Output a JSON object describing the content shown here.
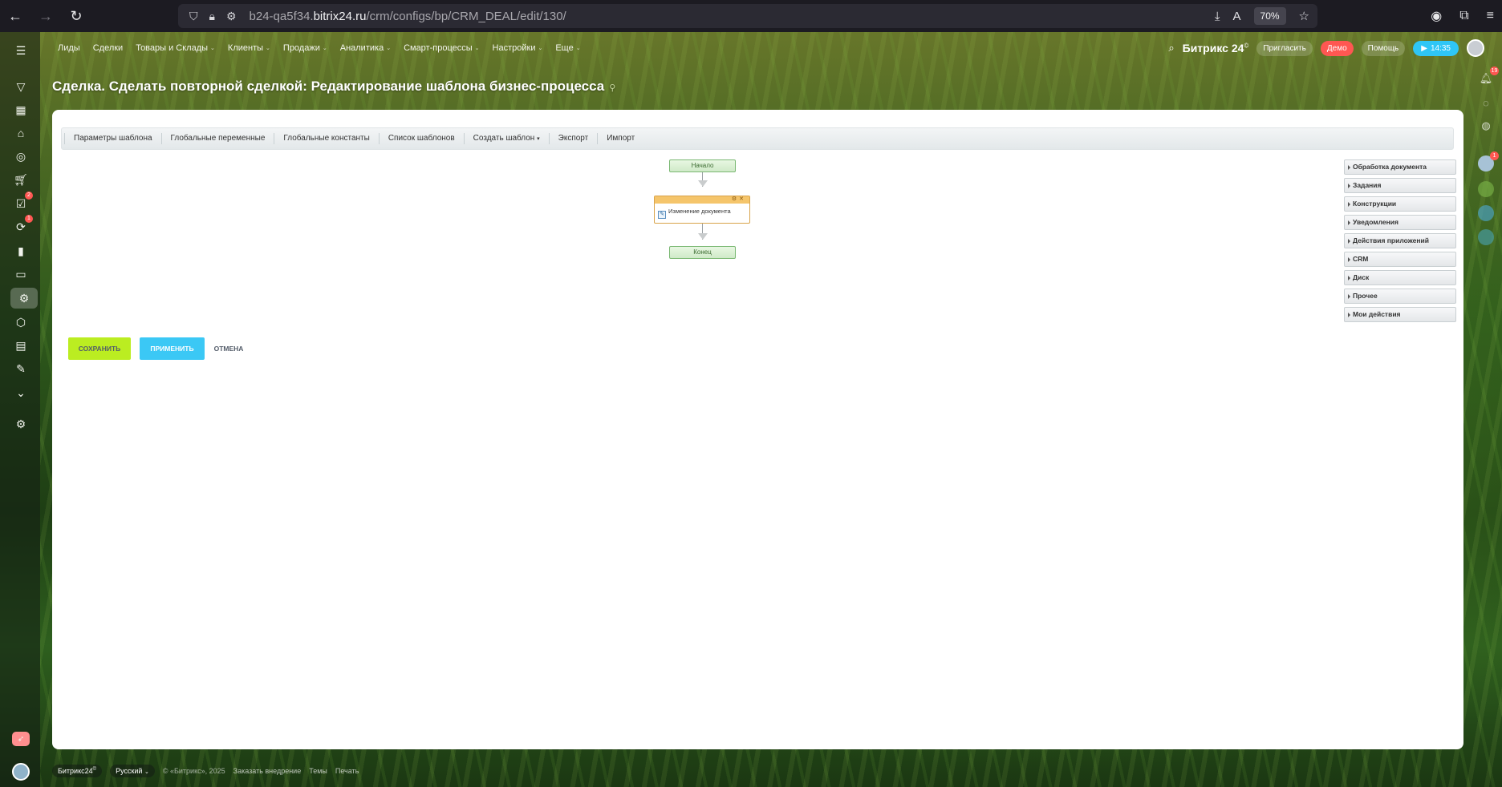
{
  "browser": {
    "url_prefix": "b24-qa5f34.",
    "url_domain": "bitrix24.ru",
    "url_path": "/crm/configs/bp/CRM_DEAL/edit/130/",
    "zoom": "70%"
  },
  "top_nav": {
    "items": [
      {
        "label": "Лиды",
        "dropdown": false
      },
      {
        "label": "Сделки",
        "dropdown": false
      },
      {
        "label": "Товары и Склады",
        "dropdown": true
      },
      {
        "label": "Клиенты",
        "dropdown": true
      },
      {
        "label": "Продажи",
        "dropdown": true
      },
      {
        "label": "Аналитика",
        "dropdown": true
      },
      {
        "label": "Смарт-процессы",
        "dropdown": true
      },
      {
        "label": "Настройки",
        "dropdown": true
      },
      {
        "label": "Еще",
        "dropdown": true
      }
    ],
    "logo": "Битрикс 24",
    "invite": "Пригласить",
    "demo": "Демо",
    "help": "Помощь",
    "time": "14:35"
  },
  "left_sidebar": {
    "badge_tasks": "2",
    "badge_feed": "1"
  },
  "right_rail": {
    "notifications_badge": "19",
    "avatar_badge": "1"
  },
  "page": {
    "title": "Сделка. Сделать повторной сделкой: Редактирование шаблона бизнес-процесса"
  },
  "toolbar": {
    "items": [
      "Параметры шаблона",
      "Глобальные переменные",
      "Глобальные константы",
      "Список шаблонов",
      "Создать шаблон",
      "Экспорт",
      "Импорт"
    ]
  },
  "workflow": {
    "start": "Начало",
    "activity": "Изменение документа",
    "end": "Конец"
  },
  "activities_panel": {
    "groups": [
      "Обработка документа",
      "Задания",
      "Конструкции",
      "Уведомления",
      "Действия приложений",
      "CRM",
      "Диск",
      "Прочее",
      "Мои действия"
    ]
  },
  "buttons": {
    "save": "Сохранить",
    "apply": "Применить",
    "cancel": "Отмена"
  },
  "footer": {
    "logo": "Битрикс24",
    "language": "Русский",
    "copyright": "© «Битрикс», 2025",
    "order": "Заказать внедрение",
    "themes": "Темы",
    "print": "Печать"
  }
}
